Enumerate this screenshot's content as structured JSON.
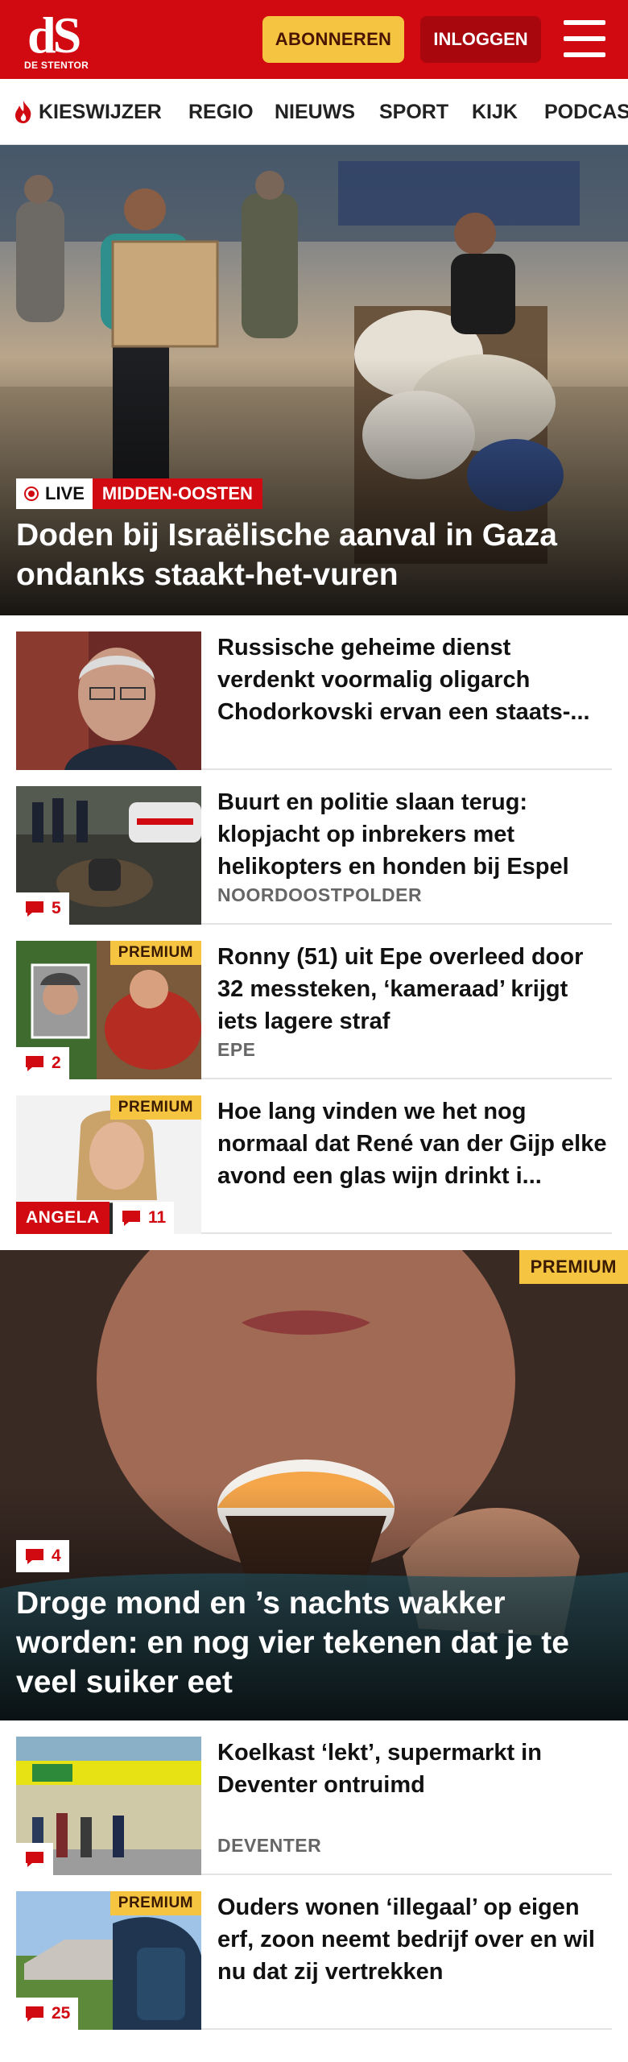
{
  "header": {
    "logo_text": "dS",
    "logo_subtitle": "DE STENTOR",
    "subscribe_label": "ABONNEREN",
    "login_label": "INLOGGEN",
    "brand_color": "#d10a11",
    "accent_color": "#f5c542"
  },
  "nav": {
    "items": [
      {
        "label": "KIESWIJZER",
        "icon": "flame-icon"
      },
      {
        "label": "REGIO"
      },
      {
        "label": "NIEUWS"
      },
      {
        "label": "SPORT"
      },
      {
        "label": "KIJK"
      },
      {
        "label": "PODCAS"
      }
    ]
  },
  "hero": {
    "live_label": "LIVE",
    "category": "MIDDEN-OOSTEN",
    "title": "Doden bij Israëlische aanval in Gaza ondanks staakt-het-vuren"
  },
  "articles": [
    {
      "title": "Russische geheime dienst verdenkt voormalig oligarch Chodorkovski ervan een staats-...",
      "location": "",
      "comments": "",
      "premium": ""
    },
    {
      "title": "Buurt en politie slaan terug: klopjacht op inbrekers met helikopters en honden bij Espel",
      "location": "NOORDOOSTPOLDER",
      "comments": "5",
      "premium": ""
    },
    {
      "title": "Ronny (51) uit Epe overleed door 32 messteken, ‘kameraad’ krijgt iets lagere straf",
      "location": "EPE",
      "comments": "2",
      "premium": "PREMIUM"
    },
    {
      "title": "Hoe lang vinden we het nog normaal dat René van der Gijp elke avond een glas wijn drinkt i...",
      "location": "",
      "comments": "11",
      "premium": "PREMIUM",
      "author": "ANGELA"
    }
  ],
  "hero2": {
    "premium": "PREMIUM",
    "comments": "4",
    "title": "Droge mond en ’s nachts wakker worden: en nog vier tekenen dat je te veel suiker eet"
  },
  "articles2": [
    {
      "title": "Koelkast ‘lekt’, supermarkt in Deventer ontruimd",
      "location": "DEVENTER",
      "comments": "",
      "premium": ""
    },
    {
      "title": "Ouders wonen ‘illegaal’ op eigen erf, zoon neemt bedrijf over en wil nu dat zij vertrekken",
      "location": "",
      "comments": "25",
      "premium": "PREMIUM"
    }
  ]
}
